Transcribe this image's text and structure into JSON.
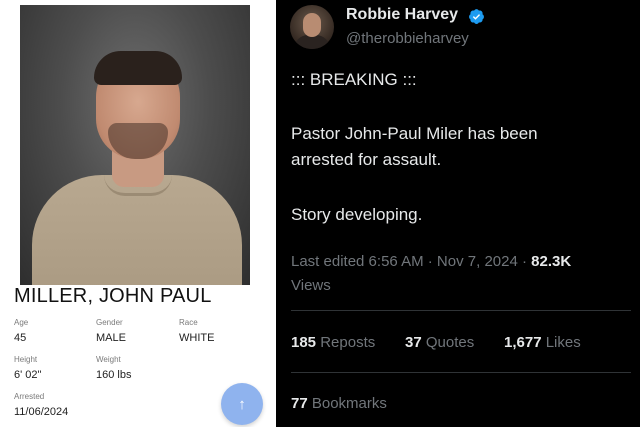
{
  "booking": {
    "name": "MILLER, JOHN PAUL",
    "fields": [
      {
        "label": "Age",
        "value": "45"
      },
      {
        "label": "Gender",
        "value": "MALE"
      },
      {
        "label": "Race",
        "value": "WHITE"
      },
      {
        "label": "Height",
        "value": "6' 02\""
      },
      {
        "label": "Weight",
        "value": "160 lbs"
      },
      {
        "label": "Arrested",
        "value": "11/06/2024"
      }
    ],
    "fab_icon": "↑",
    "colors": {
      "fab": "#8fb3ee"
    }
  },
  "tweet": {
    "display_name": "Robbie Harvey",
    "handle": "@therobbieharvey",
    "lines": [
      "::: BREAKING :::",
      "Pastor John-Paul Miler has been",
      "arrested for assault.",
      "Story developing."
    ],
    "edited_meta": "Last edited 6:56 AM · Nov 7, 2024 · ",
    "views_count": "82.3K",
    "views_label": "Views",
    "reposts_count": "185",
    "reposts_label": "Reposts",
    "quotes_count": "37",
    "quotes_label": "Quotes",
    "likes_count": "1,677",
    "likes_label": "Likes",
    "bookmarks_count": "77",
    "bookmarks_label": "Bookmarks",
    "colors": {
      "verified": "#1d9bf0",
      "background": "#000000"
    }
  }
}
